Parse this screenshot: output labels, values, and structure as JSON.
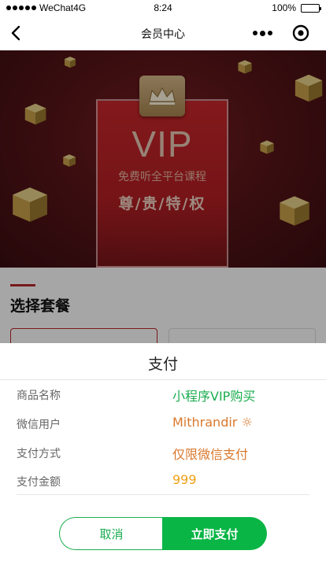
{
  "status_bar": {
    "carrier": "WeChat4G",
    "time": "8:24",
    "battery": "100%"
  },
  "nav": {
    "title": "会员中心"
  },
  "banner": {
    "vip_text": "VIP",
    "subtitle": "免费听全平台课程",
    "slogan": "尊/贵/特/权"
  },
  "section": {
    "title": "选择套餐"
  },
  "payment": {
    "title": "支付",
    "rows": [
      {
        "label": "商品名称",
        "value": "小程序VIP购买",
        "color": "#1aad4e"
      },
      {
        "label": "微信用户",
        "value": "Mithrandir ☼",
        "color": "#d9782c"
      },
      {
        "label": "支付方式",
        "value": "仅限微信支付",
        "color": "#d9782c"
      },
      {
        "label": "支付金额",
        "value": "999",
        "color": "#f0a016"
      }
    ],
    "cancel_label": "取消",
    "pay_label": "立即支付"
  },
  "colors": {
    "accent_green": "#09b545",
    "accent_red": "#b9272d"
  }
}
